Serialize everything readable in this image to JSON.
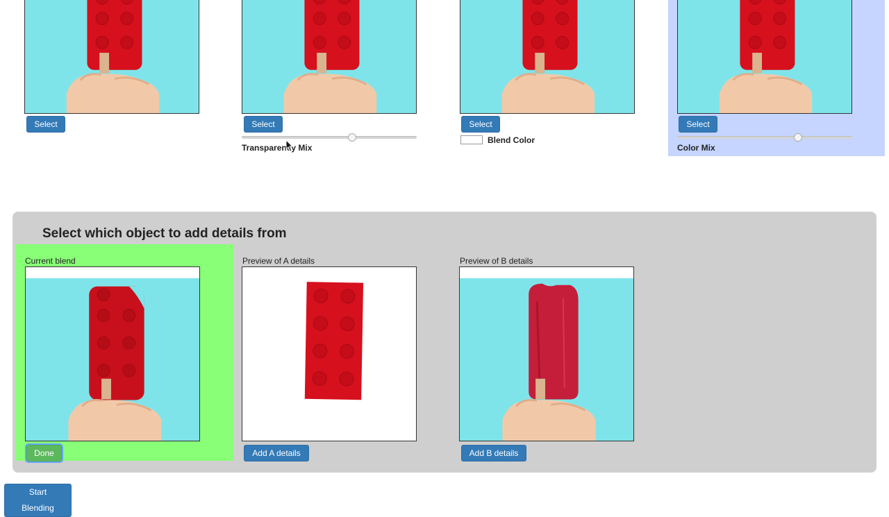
{
  "top_row": {
    "items": [
      {
        "select_label": "Select"
      },
      {
        "select_label": "Select",
        "slider_label": "Transparency Mix",
        "slider_value": 0.63
      },
      {
        "select_label": "Select",
        "blend_label": "Blend Color"
      },
      {
        "select_label": "Select",
        "slider_label": "Color Mix",
        "slider_value": 0.69,
        "highlighted": true
      }
    ]
  },
  "details_panel": {
    "title": "Select which object to add details from",
    "current": {
      "caption": "Current blend",
      "button": "Done"
    },
    "preview_a": {
      "caption": "Preview of A details",
      "button": "Add A details"
    },
    "preview_b": {
      "caption": "Preview of B details",
      "button": "Add B details"
    }
  },
  "footer": {
    "start_button": "Start Blending"
  },
  "colors": {
    "button_blue": "#337ab7",
    "button_green": "#5cb85c",
    "highlight_blue": "#c5d5ff",
    "highlight_green": "#88ff77",
    "panel_gray": "#cfcfcf",
    "sky": "#7fe4ea",
    "lego_red": "#d6101d",
    "popsicle_red": "#c41e3a"
  }
}
